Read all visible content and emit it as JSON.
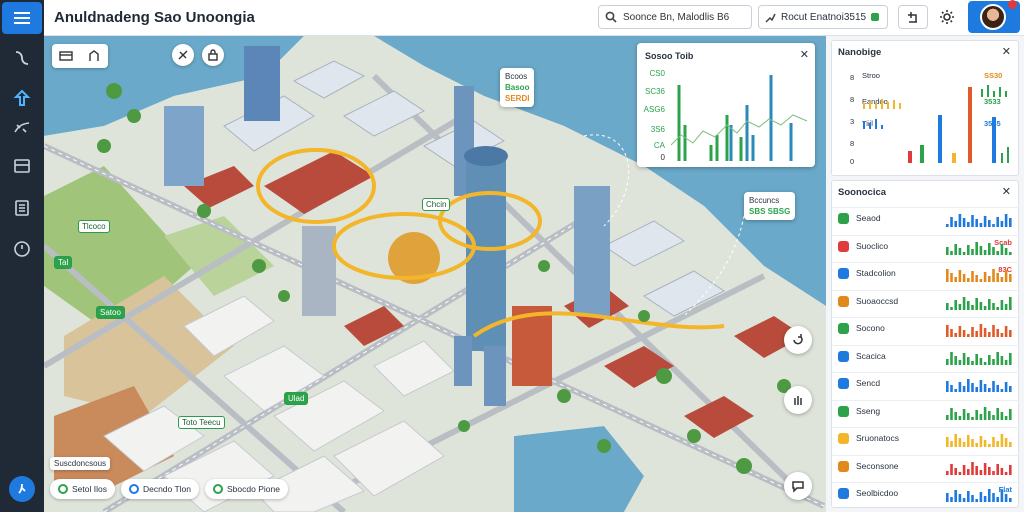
{
  "app": {
    "title": "Anuldnadeng Sao Unoongia"
  },
  "rail": {
    "items": [
      "route-icon",
      "pin-icon",
      "layers-icon",
      "card-icon",
      "document-icon",
      "compass-icon"
    ],
    "help_icon": "help-icon"
  },
  "header": {
    "search_value": "Soonce Bn, Malodlis B6",
    "filter_value": "Rocut Enatnoi3515",
    "export_icon": "export-icon",
    "settings_icon": "gear-icon"
  },
  "map": {
    "pins": [
      "Tlcoco",
      "Tal",
      "Satoo",
      "Toto Teecu",
      "Ulad",
      "Chcin"
    ],
    "callouts": [
      {
        "title": "Bcoos",
        "value": "Basoo",
        "accent": "SERDI"
      },
      {
        "title": "Bccuncs",
        "value": "SBS SBSG",
        "accent": ""
      }
    ],
    "legend_label": "Suscdoncsous",
    "pills": [
      "Setol Ilos",
      "Decndo Tlon",
      "Sbocdo Pione"
    ],
    "mini_chart": {
      "title": "Sosoo Toib",
      "y_labels": [
        "CS0",
        "SC36",
        "ASG6",
        "3S6",
        "CA",
        "0"
      ]
    }
  },
  "panel_top": {
    "title": "Nanobige",
    "rows": [
      {
        "label": "Stroo",
        "value": "SS30"
      },
      {
        "label": "Eandoo",
        "value": "3533"
      },
      {
        "label": "Tiiil",
        "value": "3535"
      }
    ],
    "y_labels": [
      "8",
      "8",
      "3",
      "8",
      "0"
    ]
  },
  "panel_bottom": {
    "title": "Soonocica",
    "rows": [
      {
        "label": "Seaod",
        "value": ""
      },
      {
        "label": "Suoclico",
        "value": "Scab"
      },
      {
        "label": "Stadcolion",
        "value": "83C"
      },
      {
        "label": "Suoaoccsd",
        "value": ""
      },
      {
        "label": "Socono",
        "value": ""
      },
      {
        "label": "Scacica",
        "value": ""
      },
      {
        "label": "Sencd",
        "value": ""
      },
      {
        "label": "Sseng",
        "value": ""
      },
      {
        "label": "Sruonatocs",
        "value": ""
      },
      {
        "label": "Seconsone",
        "value": ""
      },
      {
        "label": "Seolbicdoo",
        "value": "Flat"
      }
    ]
  },
  "colors": {
    "accent": "#1f7ae0",
    "green": "#2ca24b",
    "orange": "#e08a1e",
    "red": "#e03a3a",
    "yellow": "#f3b62b"
  }
}
